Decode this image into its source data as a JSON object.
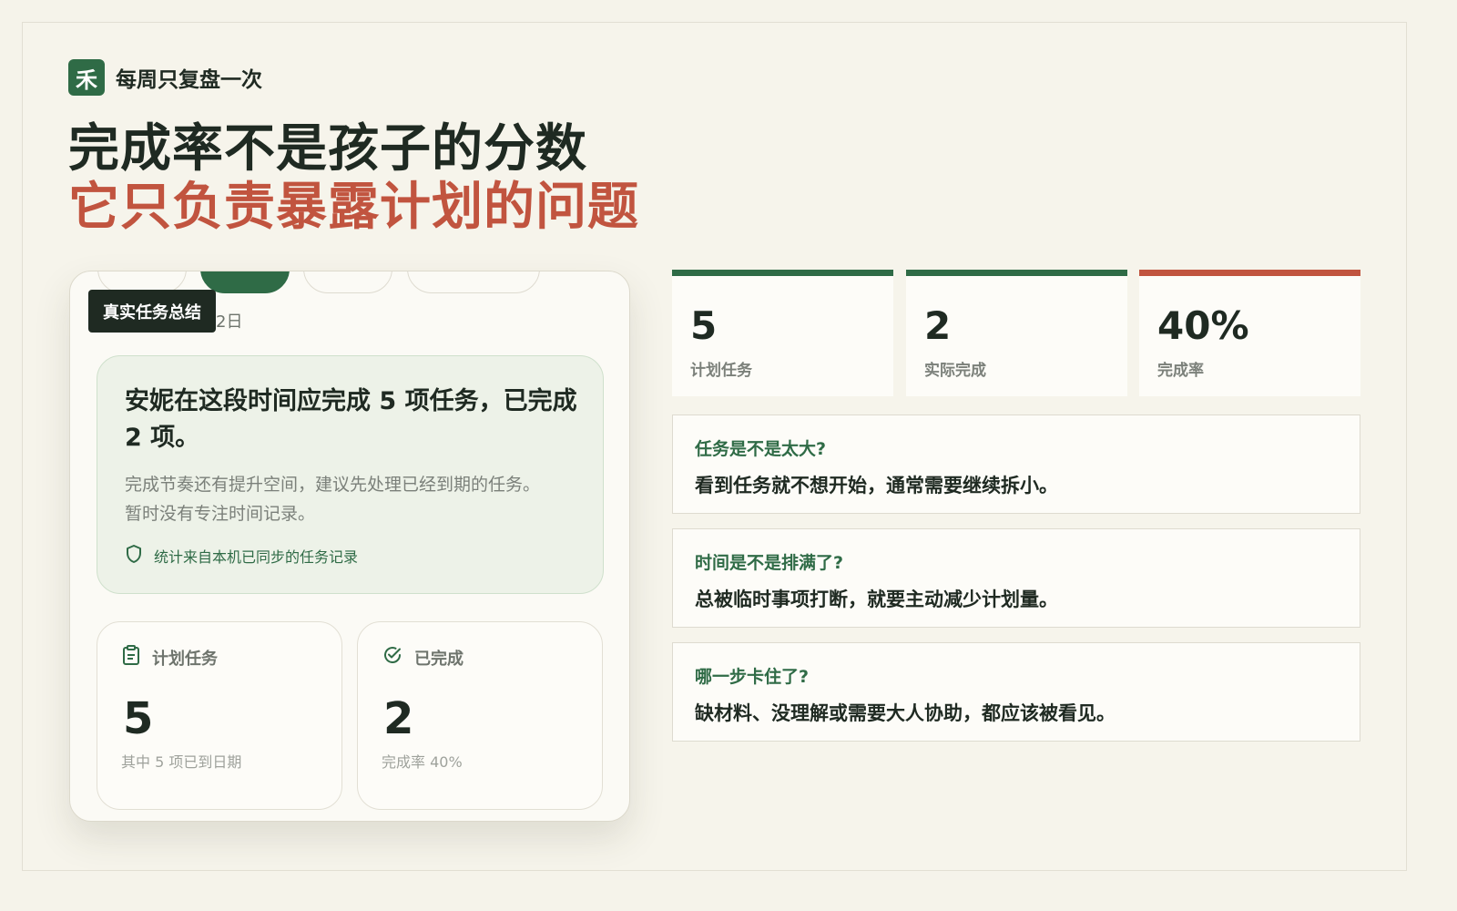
{
  "brand": {
    "logo_char": "禾",
    "name": "每周只复盘一次"
  },
  "headline": {
    "line1": "完成率不是孩子的分数",
    "line2": "它只负责暴露计划的问题"
  },
  "phone": {
    "date_fragment": "2日",
    "tag": "真实任务总结",
    "summary": {
      "title": "安妮在这段时间应完成 5 项任务，已完成 2 项。",
      "description": "完成节奏还有提升空间，建议先处理已经到期的任务。 暂时没有专注时间记录。",
      "note": "统计来自本机已同步的任务记录"
    },
    "stats": [
      {
        "label": "计划任务",
        "value": "5",
        "sub": "其中 5 项已到日期",
        "icon": "clipboard-icon"
      },
      {
        "label": "已完成",
        "value": "2",
        "sub": "完成率 40%",
        "icon": "check-circle-icon"
      }
    ]
  },
  "metrics": [
    {
      "value": "5",
      "label": "计划任务",
      "accent": "#2f6b46"
    },
    {
      "value": "2",
      "label": "实际完成",
      "accent": "#2f6b46"
    },
    {
      "value": "40%",
      "label": "完成率",
      "accent": "#c1543f"
    }
  ],
  "questions": [
    {
      "title": "任务是不是太大?",
      "body": "看到任务就不想开始，通常需要继续拆小。"
    },
    {
      "title": "时间是不是排满了?",
      "body": "总被临时事项打断，就要主动减少计划量。"
    },
    {
      "title": "哪一步卡住了?",
      "body": "缺材料、没理解或需要大人协助，都应该被看见。"
    }
  ],
  "colors": {
    "primary": "#2f6b46",
    "accent": "#c1543f",
    "background": "#f5f3ea"
  }
}
